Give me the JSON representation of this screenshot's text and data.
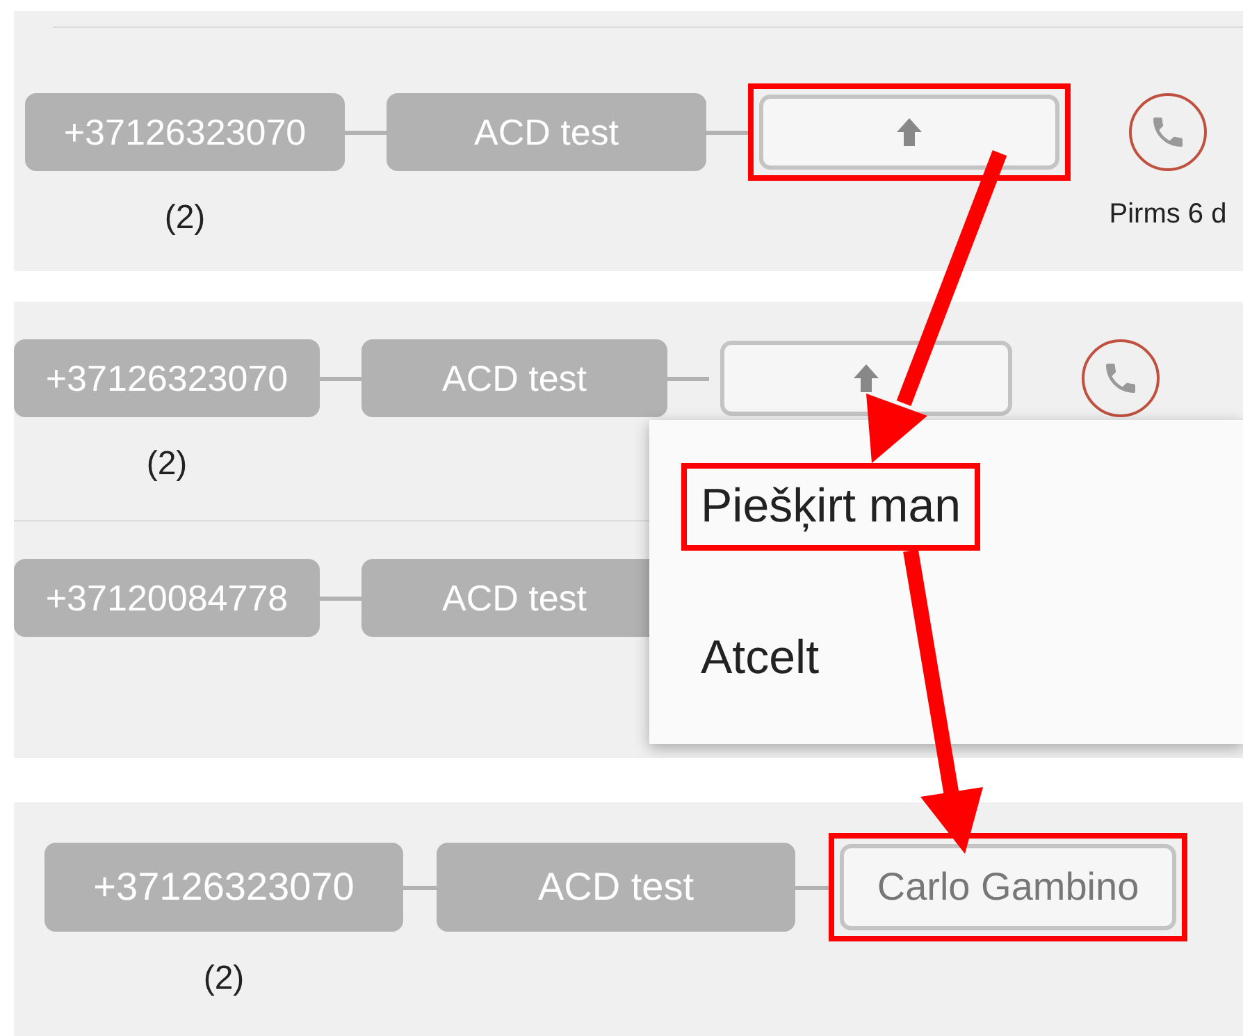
{
  "panels": [
    {
      "rows": [
        {
          "number": "+37126323070",
          "queue": "ACD test",
          "agent": {
            "kind": "assign",
            "highlighted": true
          },
          "count": "(2)",
          "call": true,
          "time": "Pirms 6 d"
        }
      ]
    },
    {
      "rows": [
        {
          "number": "+37126323070",
          "queue": "ACD test",
          "agent": {
            "kind": "assign",
            "highlighted": false
          },
          "count": "(2)",
          "call": true
        },
        {
          "number": "+37120084778",
          "queue": "ACD test"
        }
      ],
      "menu": {
        "items": [
          {
            "label": "Piešķirt man",
            "highlighted": true
          },
          {
            "label": "Atcelt",
            "highlighted": false
          }
        ]
      }
    },
    {
      "rows": [
        {
          "number": "+37126323070",
          "queue": "ACD test",
          "agent": {
            "kind": "name",
            "name": "Carlo Gambino",
            "highlighted": true
          },
          "count": "(2)"
        }
      ]
    }
  ]
}
